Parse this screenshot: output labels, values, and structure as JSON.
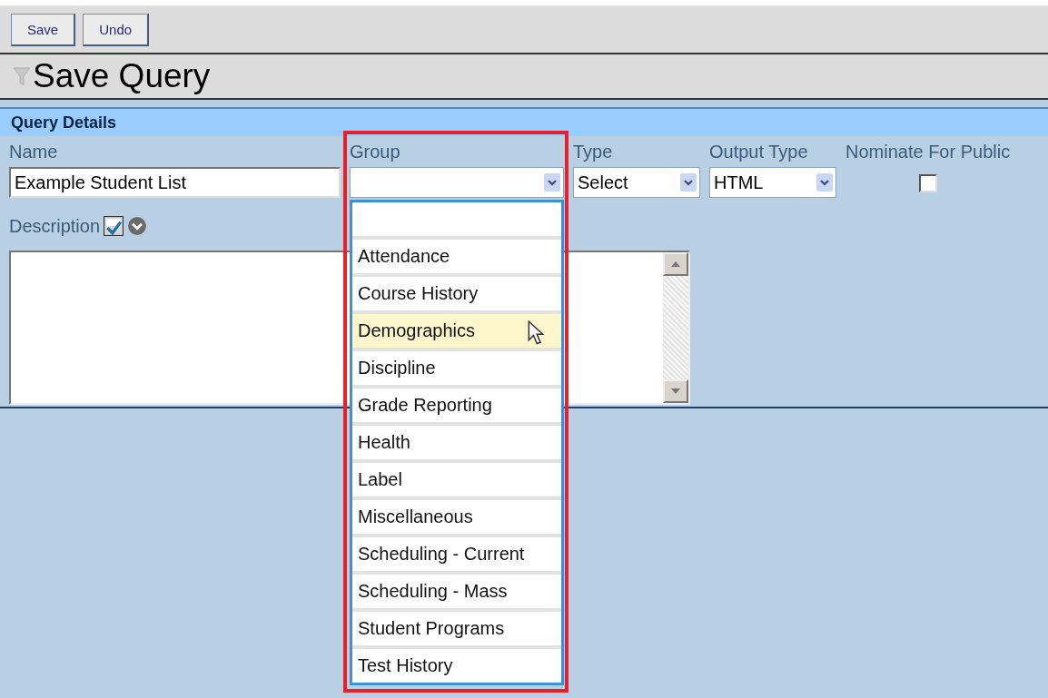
{
  "toolbar": {
    "buttons": [
      "Save",
      "Undo"
    ]
  },
  "title": "Save Query",
  "section": {
    "title": "Query Details"
  },
  "fields": {
    "name": {
      "label": "Name",
      "value": "Example Student List"
    },
    "group": {
      "label": "Group",
      "expanded": true,
      "highlighted": true
    },
    "type": {
      "label": "Type",
      "value": "Select"
    },
    "output_type": {
      "label": "Output Type",
      "value": "HTML"
    },
    "nominate": {
      "label": "Nominate For Public",
      "checked": false
    },
    "description": {
      "label": "Description"
    }
  },
  "group_options": [
    {
      "kind": "blank",
      "selected": false
    },
    {
      "kind": "option",
      "label": "Attendance",
      "selected": false
    },
    {
      "kind": "option",
      "label": "Course History",
      "selected": false
    },
    {
      "kind": "option",
      "label": "Demographics",
      "selected": true
    },
    {
      "kind": "option",
      "label": "Discipline",
      "selected": false
    },
    {
      "kind": "option",
      "label": "Grade Reporting",
      "selected": false
    },
    {
      "kind": "option",
      "label": "Health",
      "selected": false
    },
    {
      "kind": "option",
      "label": "Label",
      "selected": false
    },
    {
      "kind": "option",
      "label": "Miscellaneous",
      "selected": false
    },
    {
      "kind": "option",
      "label": "Scheduling - Current",
      "selected": false
    },
    {
      "kind": "option",
      "label": "Scheduling - Mass",
      "selected": false
    },
    {
      "kind": "option",
      "label": "Student Programs",
      "selected": false
    },
    {
      "kind": "option",
      "label": "Test History",
      "selected": false
    }
  ]
}
